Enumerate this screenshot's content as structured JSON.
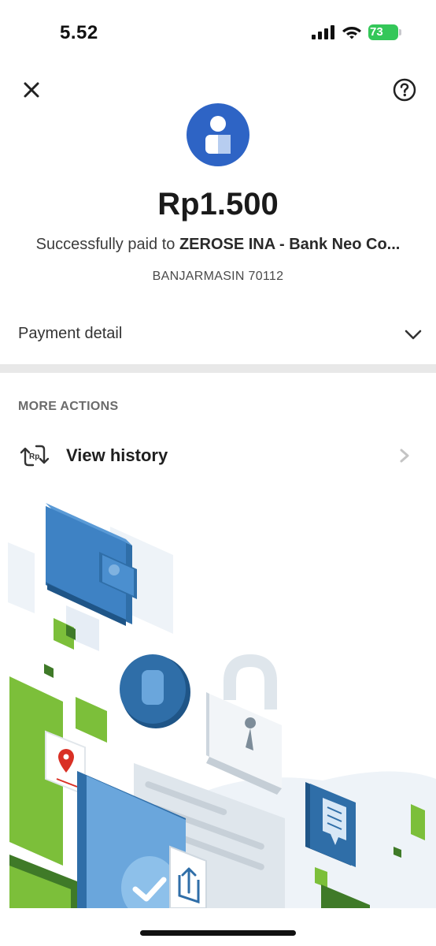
{
  "status_bar": {
    "time": "5.52",
    "battery": "73",
    "icons": [
      "cellular-signal-icon",
      "wifi-icon",
      "battery-charging-icon"
    ]
  },
  "header": {
    "close_icon": "close-icon",
    "help_icon": "help-circle-icon"
  },
  "receipt": {
    "avatar_icon": "user-icon",
    "amount": "Rp1.500",
    "paid_prefix": "Successfully paid to ",
    "merchant": "ZEROSE INA - Bank Neo Co...",
    "location": "BANJARMASIN 70112"
  },
  "payment_detail": {
    "label": "Payment detail",
    "icon": "chevron-down-icon"
  },
  "more_actions": {
    "title": "MORE ACTIONS",
    "items": [
      {
        "label": "View history",
        "icon": "rupiah-history-icon",
        "trailing_icon": "chevron-right-icon"
      }
    ]
  },
  "colors": {
    "avatar_blue": "#2e64c5",
    "battery_green": "#34c759",
    "illustration_blue": "#3e7fbf",
    "illustration_green": "#7cbf3a",
    "divider_gray": "#e8e8e8"
  }
}
